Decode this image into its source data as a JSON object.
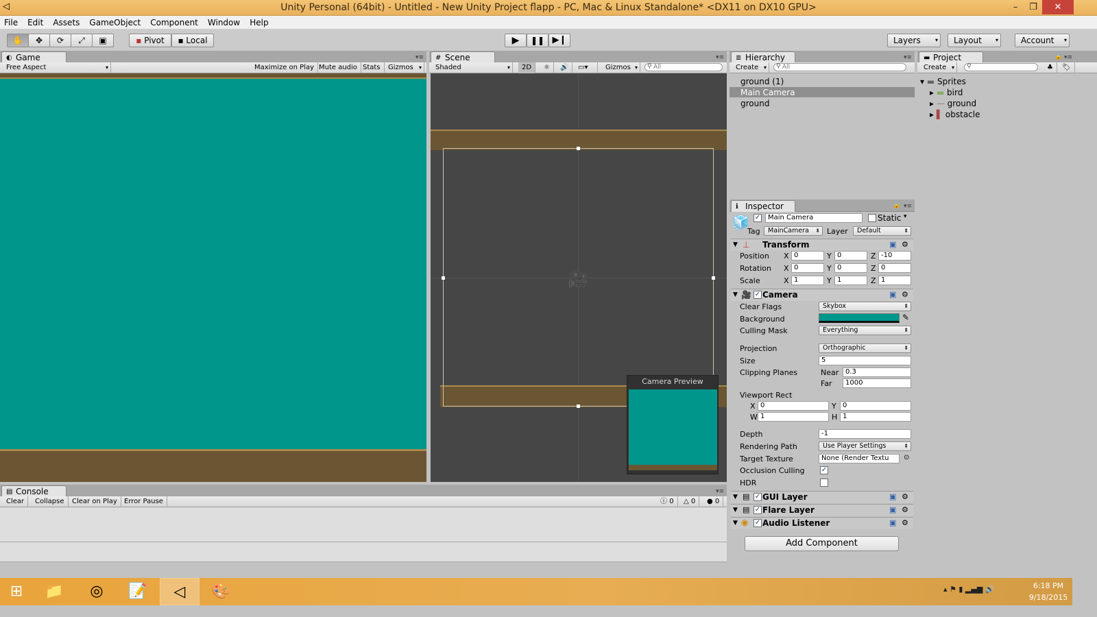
{
  "window": {
    "title": "Unity Personal (64bit) - Untitled - New Unity Project flapp - PC, Mac & Linux Standalone* <DX11 on DX10 GPU>",
    "minimize": "–",
    "maximize": "❐",
    "close": "✕"
  },
  "menu": [
    "File",
    "Edit",
    "Assets",
    "GameObject",
    "Component",
    "Window",
    "Help"
  ],
  "toolbar": {
    "pivot": "Pivot",
    "local": "Local",
    "layers": "Layers",
    "layout": "Layout",
    "account": "Account"
  },
  "game": {
    "tab": "Game",
    "aspect": "Free Aspect",
    "maximize": "Maximize on Play",
    "mute": "Mute audio",
    "stats": "Stats",
    "gizmos": "Gizmos",
    "bg_color": "#00968c"
  },
  "scene": {
    "tab": "Scene",
    "shading": "Shaded",
    "mode2d": "2D",
    "gizmos": "Gizmos",
    "search": "All",
    "preview_title": "Camera Preview"
  },
  "hierarchy": {
    "tab": "Hierarchy",
    "create": "Create",
    "search": "All",
    "items": [
      "ground (1)",
      "Main Camera",
      "ground"
    ]
  },
  "project": {
    "tab": "Project",
    "create": "Create",
    "folder": "Sprites",
    "items": [
      "bird",
      "ground",
      "obstacle"
    ]
  },
  "inspector": {
    "tab": "Inspector",
    "object_name": "Main Camera",
    "static": "Static",
    "tag_label": "Tag",
    "tag": "MainCamera",
    "layer_label": "Layer",
    "layer": "Default",
    "transform": {
      "title": "Transform",
      "position_label": "Position",
      "position": [
        "0",
        "0",
        "-10"
      ],
      "rotation_label": "Rotation",
      "rotation": [
        "0",
        "0",
        "0"
      ],
      "scale_label": "Scale",
      "scale": [
        "1",
        "1",
        "1"
      ],
      "axes": [
        "X",
        "Y",
        "Z"
      ]
    },
    "camera": {
      "title": "Camera",
      "clear_flags_label": "Clear Flags",
      "clear_flags": "Skybox",
      "background_label": "Background",
      "background": "#00968c",
      "culling_label": "Culling Mask",
      "culling": "Everything",
      "projection_label": "Projection",
      "projection": "Orthographic",
      "size_label": "Size",
      "size": "5",
      "clipping_label": "Clipping Planes",
      "near_label": "Near",
      "near": "0.3",
      "far_label": "Far",
      "far": "1000",
      "viewport_label": "Viewport Rect",
      "vx_label": "X",
      "vx": "0",
      "vy_label": "Y",
      "vy": "0",
      "vw_label": "W",
      "vw": "1",
      "vh_label": "H",
      "vh": "1",
      "depth_label": "Depth",
      "depth": "-1",
      "rendering_label": "Rendering Path",
      "rendering": "Use Player Settings",
      "target_label": "Target Texture",
      "target": "None (Render Textu",
      "occlusion_label": "Occlusion Culling",
      "occlusion": true,
      "hdr_label": "HDR",
      "hdr": false
    },
    "gui_layer": "GUI Layer",
    "flare_layer": "Flare Layer",
    "audio_listener": "Audio Listener",
    "add_component": "Add Component"
  },
  "console": {
    "tab": "Console",
    "clear": "Clear",
    "collapse": "Collapse",
    "clear_on_play": "Clear on Play",
    "error_pause": "Error Pause",
    "log_count": "0",
    "warn_count": "0",
    "error_count": "0"
  },
  "taskbar": {
    "time": "6:18 PM",
    "date": "9/18/2015"
  }
}
